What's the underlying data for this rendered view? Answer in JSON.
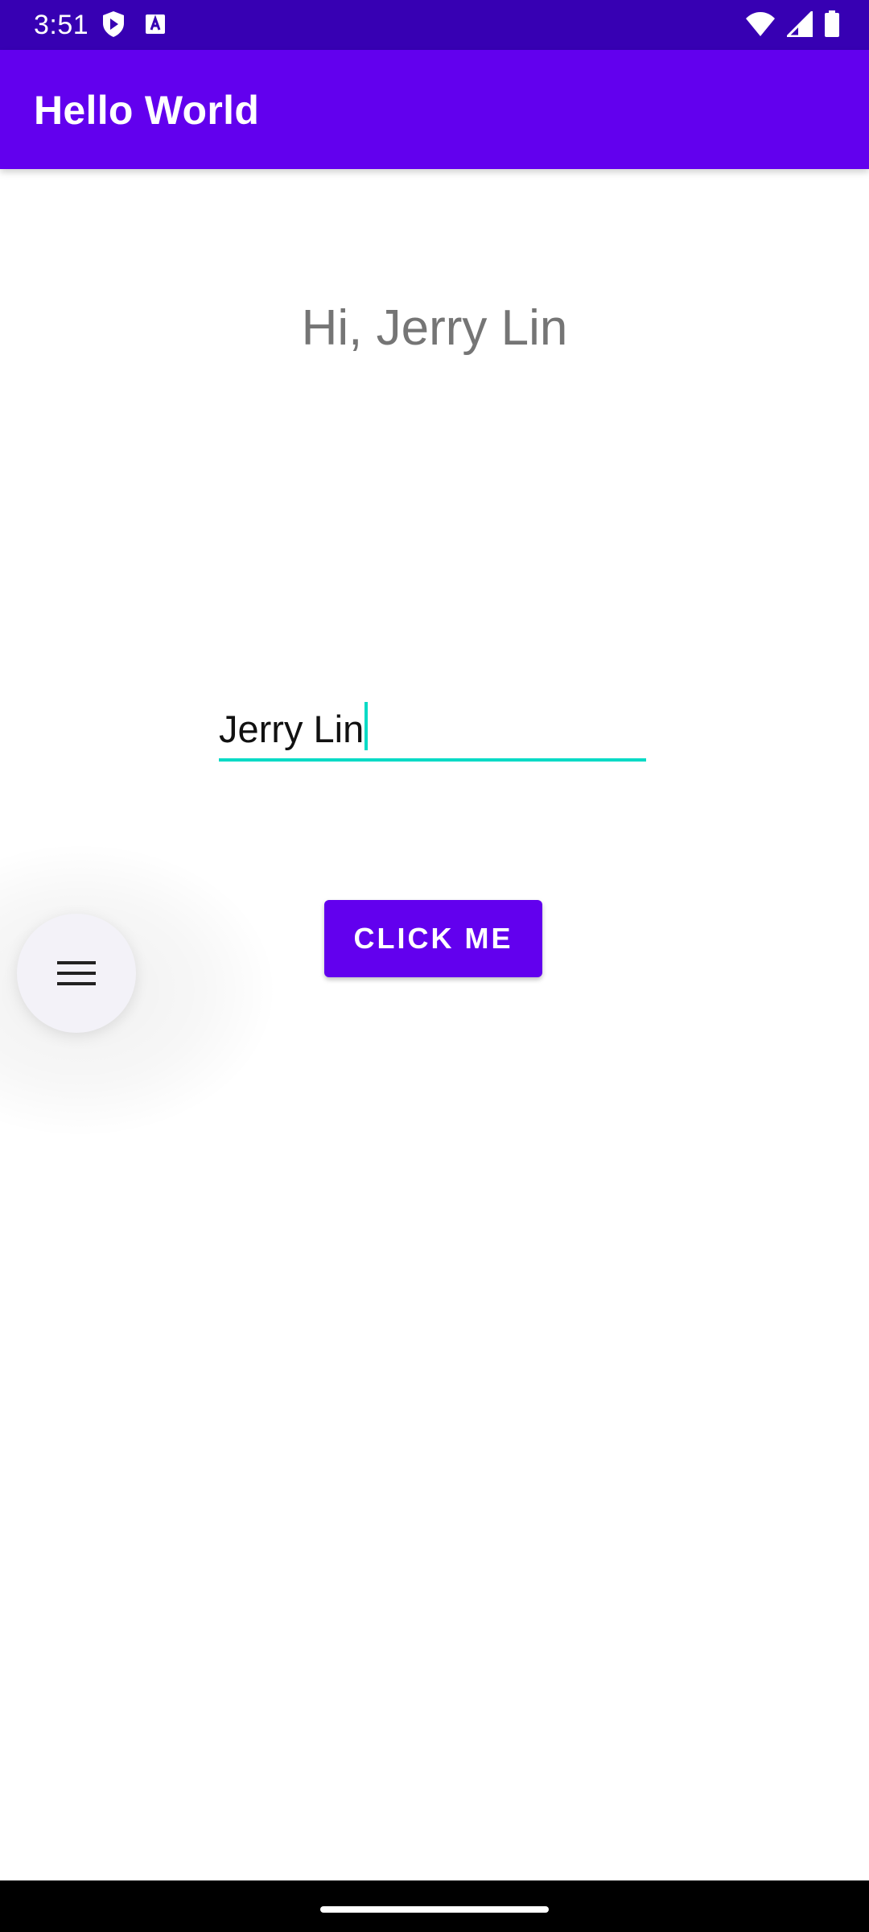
{
  "status_bar": {
    "time": "3:51",
    "left_icons": [
      "shield-play-icon",
      "keyboard-a-icon"
    ],
    "right_icons": [
      "wifi-icon",
      "signal-icon",
      "battery-icon"
    ],
    "color": "#3700B3"
  },
  "app_bar": {
    "title": "Hello World",
    "color": "#6200EE"
  },
  "main": {
    "greeting": "Hi, Jerry Lin",
    "name_input": {
      "value": "Jerry Lin",
      "accent_color": "#03DAC5"
    },
    "button_label": "CLICK ME"
  },
  "floating_menu": {
    "icon": "menu-icon"
  },
  "nav_bar": {
    "handle": "home-gesture-handle"
  }
}
